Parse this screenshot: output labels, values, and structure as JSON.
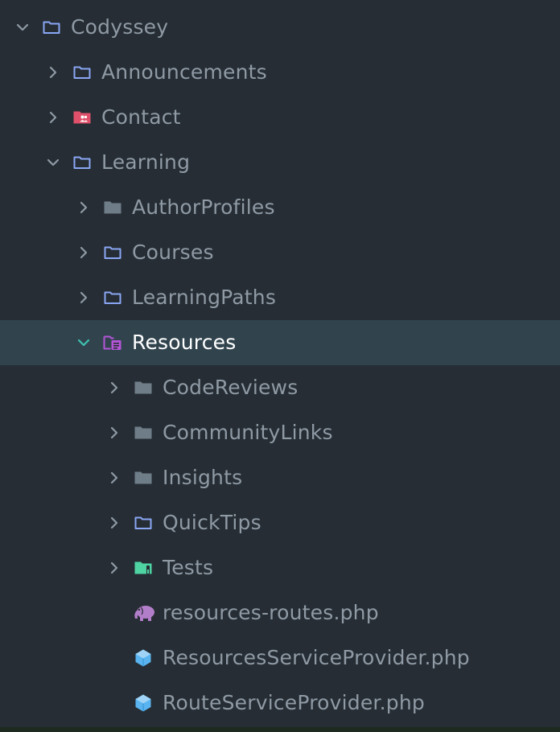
{
  "tree": [
    {
      "label": "Codyssey",
      "depth": 0,
      "chevron": "down",
      "icon": "folder-icon",
      "icon_color": "#8aa7f5"
    },
    {
      "label": "Announcements",
      "depth": 1,
      "chevron": "right",
      "icon": "folder-icon",
      "icon_color": "#8aa7f5"
    },
    {
      "label": "Contact",
      "depth": 1,
      "chevron": "right",
      "icon": "contacts-folder-icon",
      "icon_color": "#e0506a"
    },
    {
      "label": "Learning",
      "depth": 1,
      "chevron": "down",
      "icon": "folder-icon",
      "icon_color": "#8aa7f5"
    },
    {
      "label": "AuthorProfiles",
      "depth": 2,
      "chevron": "right",
      "icon": "folder-filled-icon",
      "icon_color": "#6f7d89"
    },
    {
      "label": "Courses",
      "depth": 2,
      "chevron": "right",
      "icon": "folder-icon",
      "icon_color": "#8aa7f5"
    },
    {
      "label": "LearningPaths",
      "depth": 2,
      "chevron": "right",
      "icon": "folder-icon",
      "icon_color": "#8aa7f5"
    },
    {
      "label": "Resources",
      "depth": 2,
      "chevron": "down",
      "icon": "resources-folder-icon",
      "icon_color": "#b455d8",
      "selected": true
    },
    {
      "label": "CodeReviews",
      "depth": 3,
      "chevron": "right",
      "icon": "folder-filled-icon",
      "icon_color": "#6f7d89"
    },
    {
      "label": "CommunityLinks",
      "depth": 3,
      "chevron": "right",
      "icon": "folder-filled-icon",
      "icon_color": "#6f7d89"
    },
    {
      "label": "Insights",
      "depth": 3,
      "chevron": "right",
      "icon": "folder-filled-icon",
      "icon_color": "#6f7d89"
    },
    {
      "label": "QuickTips",
      "depth": 3,
      "chevron": "right",
      "icon": "folder-icon",
      "icon_color": "#8aa7f5"
    },
    {
      "label": "Tests",
      "depth": 3,
      "chevron": "right",
      "icon": "test-folder-icon",
      "icon_color": "#4fd3a3"
    },
    {
      "label": "resources-routes.php",
      "depth": 3,
      "chevron": "none",
      "icon": "php-elephant-icon",
      "icon_color": "#b37ec9"
    },
    {
      "label": "ResourcesServiceProvider.php",
      "depth": 3,
      "chevron": "none",
      "icon": "php-class-icon",
      "icon_color": "#5ab4f0"
    },
    {
      "label": "RouteServiceProvider.php",
      "depth": 3,
      "chevron": "none",
      "icon": "php-class-icon",
      "icon_color": "#5ab4f0"
    }
  ],
  "colors": {
    "background": "#262d34",
    "selection": "#31444e",
    "text": "#8f9aa5",
    "text_selected": "#ffffff",
    "chevron": "#8f9aa5",
    "chevron_selected": "#3fc1b0"
  }
}
